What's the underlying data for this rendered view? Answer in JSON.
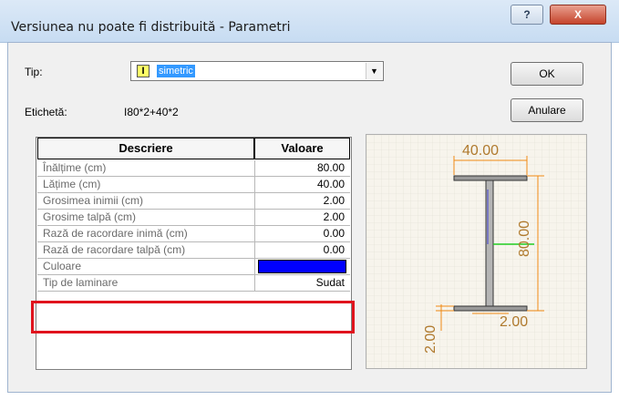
{
  "window": {
    "title": "Versiunea nu poate fi distribuită - Parametri"
  },
  "titlebar": {
    "help_glyph": "?",
    "close_glyph": "X"
  },
  "form": {
    "tip_label": "Tip:",
    "tip_value": "simetric",
    "eticheta_label": "Etichetă:",
    "eticheta_value": "I80*2+40*2"
  },
  "buttons": {
    "ok": "OK",
    "cancel": "Anulare"
  },
  "table": {
    "headers": [
      "Descriere",
      "Valoare"
    ],
    "rows": [
      {
        "label": "Înălțime (cm)",
        "value": "80.00"
      },
      {
        "label": "Lățime (cm)",
        "value": "40.00"
      },
      {
        "label": "Grosimea inimii (cm)",
        "value": "2.00"
      },
      {
        "label": "Grosime talpă (cm)",
        "value": "2.00"
      },
      {
        "label": "Rază de racordare inimă (cm)",
        "value": "0.00"
      },
      {
        "label": "Rază de racordare talpă (cm)",
        "value": "0.00"
      },
      {
        "label": "Culoare",
        "value": ""
      },
      {
        "label": "Tip de laminare",
        "value": "Sudat"
      }
    ],
    "color_swatch": "#0000ff",
    "highlight_color": "#e0131d"
  },
  "preview": {
    "width_label": "40.00",
    "height_label": "80.00",
    "web_label": "2.00",
    "flange_label": "2.00",
    "dim_color": "#f08a14",
    "grid_color": "#c8c8c8"
  }
}
